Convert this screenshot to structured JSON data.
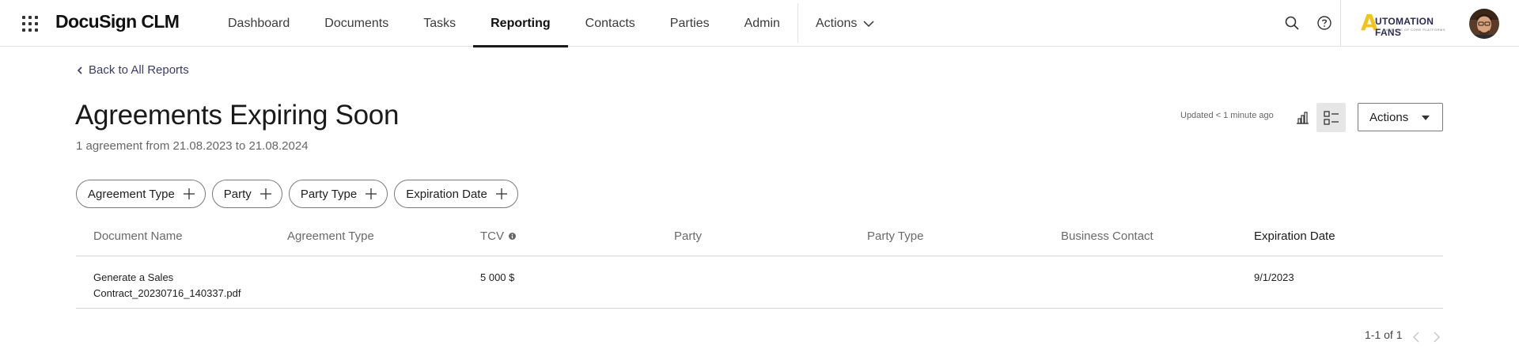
{
  "header": {
    "brand": "DocuSign CLM",
    "nav": [
      {
        "label": "Dashboard"
      },
      {
        "label": "Documents"
      },
      {
        "label": "Tasks"
      },
      {
        "label": "Reporting",
        "active": true
      },
      {
        "label": "Contacts"
      },
      {
        "label": "Parties"
      },
      {
        "label": "Admin"
      }
    ],
    "actions_label": "Actions",
    "logo_text": "UTOMATION FANS",
    "logo_letter": "A",
    "logo_sub": "MAKE LIFE OF CORE PLATFORMS",
    "icons": [
      "apps-grid-icon",
      "search-icon",
      "help-icon",
      "chevron-down-icon"
    ]
  },
  "page": {
    "back_label": "Back to All Reports",
    "title": "Agreements Expiring Soon",
    "subtitle": "1 agreement from 21.08.2023 to 21.08.2024",
    "updated": "Updated < 1 minute ago",
    "actions_button": "Actions",
    "filters": [
      {
        "label": "Agreement Type"
      },
      {
        "label": "Party"
      },
      {
        "label": "Party Type"
      },
      {
        "label": "Expiration Date"
      }
    ]
  },
  "table": {
    "columns": [
      "Document Name",
      "Agreement Type",
      "TCV",
      "Party",
      "Party Type",
      "Business Contact",
      "Expiration Date"
    ],
    "sorted_column": "Expiration Date",
    "rows": [
      {
        "document_name": "Generate a Sales Contract_20230716_140337.pdf",
        "agreement_type": "",
        "tcv": "5 000 $",
        "party": "",
        "party_type": "",
        "business_contact": "",
        "expiration_date": "9/1/2023"
      }
    ]
  },
  "pagination": {
    "text": "1-1 of 1"
  },
  "colors": {
    "accent": "#1b1b1b",
    "logo_yellow": "#f0c419",
    "logo_navy": "#2b2b54",
    "link": "#3b3b66"
  }
}
